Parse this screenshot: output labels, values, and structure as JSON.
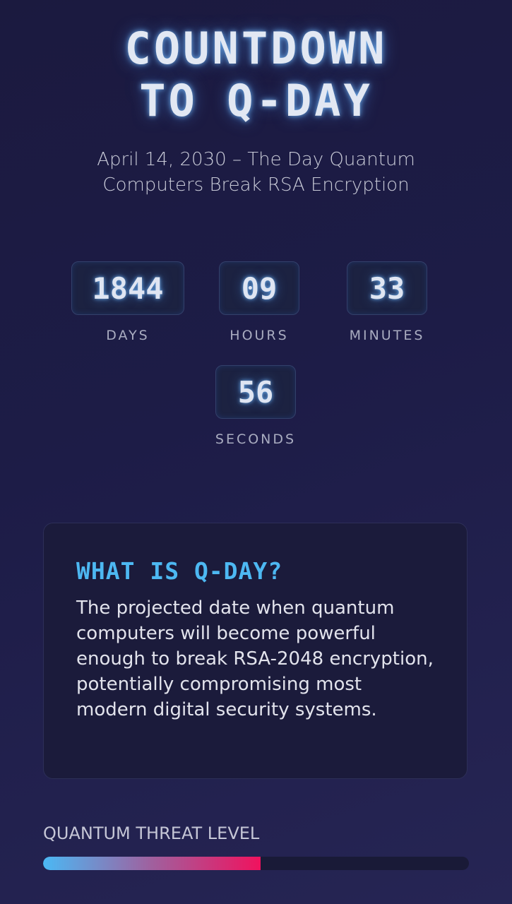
{
  "header": {
    "title_line1": "COUNTDOWN",
    "title_line2": "TO Q-DAY",
    "subtitle": "April 14, 2030 – The Day Quantum Computers Break RSA Encryption"
  },
  "countdown": {
    "days": {
      "value": "1844",
      "label": "DAYS"
    },
    "hours": {
      "value": "09",
      "label": "HOURS"
    },
    "minutes": {
      "value": "33",
      "label": "MINUTES"
    },
    "seconds": {
      "value": "56",
      "label": "SECONDS"
    }
  },
  "info": {
    "title": "WHAT IS Q-DAY?",
    "text": "The projected date when quantum computers will become powerful enough to break RSA-2048 encryption, potentially compromising most modern digital security systems."
  },
  "threat": {
    "label": "QUANTUM THREAT LEVEL",
    "level_fraction": 0.51
  },
  "colors": {
    "accent": "#4db8f2",
    "threat_end": "#f0125e",
    "background": "#1d1c47"
  }
}
